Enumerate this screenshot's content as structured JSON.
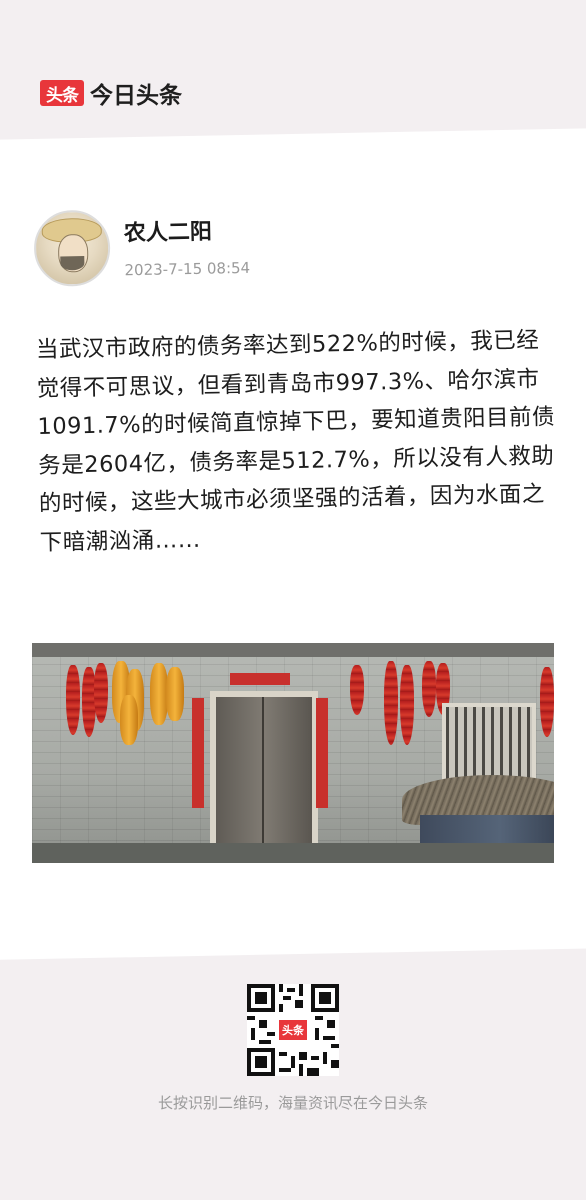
{
  "brand": {
    "logo_text": "头条",
    "name": "今日头条",
    "accent_color": "#e8363b"
  },
  "post": {
    "author": {
      "name": "农人二阳",
      "avatar_icon": "farmer-straw-hat-avatar"
    },
    "timestamp": "2023-7-15 08:54",
    "text": "当武汉市政府的债务率达到522%的时候，我已经觉得不可思议，但看到青岛市997.3%、哈尔滨市1091.7%的时候简直惊掉下巴，要知道贵阳目前债务是2604亿，债务率是512.7%，所以没有人救助的时候，这些大城市必须坚强的活着，因为水面之下暗潮汹涌……",
    "image": {
      "description_icon": "village-wall-photo"
    }
  },
  "footer": {
    "qr_badge": "头条",
    "caption": "长按识别二维码，海量资讯尽在今日头条"
  }
}
